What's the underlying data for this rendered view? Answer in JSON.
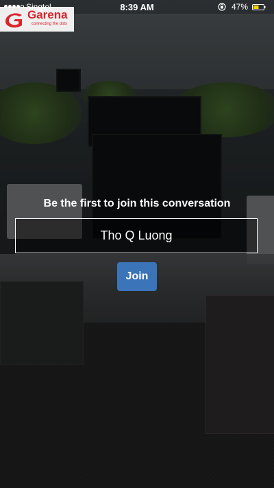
{
  "status_bar": {
    "carrier": "Singtel",
    "time": "8:39 AM",
    "battery_percent": "47%",
    "signal_bars_filled": 4,
    "signal_bars_total": 5,
    "battery_color": "#f5d000",
    "lock_icon": "orientation-lock-icon"
  },
  "watermark": {
    "brand": "Garena",
    "tagline": "connecting the dots",
    "color": "#d9262c"
  },
  "join": {
    "title": "Be the first to join this conversation",
    "name_value": "Tho Q Luong",
    "button_label": "Join",
    "button_color": "#3b74b8"
  }
}
